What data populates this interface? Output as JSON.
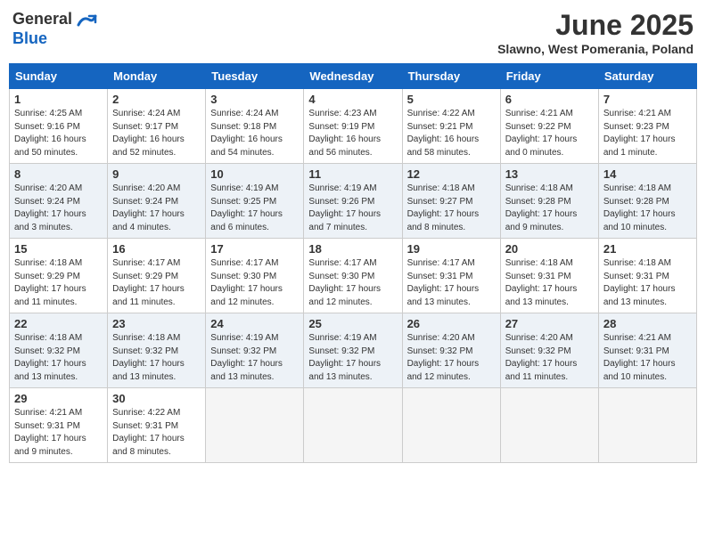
{
  "header": {
    "logo_general": "General",
    "logo_blue": "Blue",
    "month_title": "June 2025",
    "subtitle": "Slawno, West Pomerania, Poland"
  },
  "days_of_week": [
    "Sunday",
    "Monday",
    "Tuesday",
    "Wednesday",
    "Thursday",
    "Friday",
    "Saturday"
  ],
  "weeks": [
    [
      {
        "day": "1",
        "sunrise": "4:25 AM",
        "sunset": "9:16 PM",
        "daylight": "16 hours and 50 minutes."
      },
      {
        "day": "2",
        "sunrise": "4:24 AM",
        "sunset": "9:17 PM",
        "daylight": "16 hours and 52 minutes."
      },
      {
        "day": "3",
        "sunrise": "4:24 AM",
        "sunset": "9:18 PM",
        "daylight": "16 hours and 54 minutes."
      },
      {
        "day": "4",
        "sunrise": "4:23 AM",
        "sunset": "9:19 PM",
        "daylight": "16 hours and 56 minutes."
      },
      {
        "day": "5",
        "sunrise": "4:22 AM",
        "sunset": "9:21 PM",
        "daylight": "16 hours and 58 minutes."
      },
      {
        "day": "6",
        "sunrise": "4:21 AM",
        "sunset": "9:22 PM",
        "daylight": "17 hours and 0 minutes."
      },
      {
        "day": "7",
        "sunrise": "4:21 AM",
        "sunset": "9:23 PM",
        "daylight": "17 hours and 1 minute."
      }
    ],
    [
      {
        "day": "8",
        "sunrise": "4:20 AM",
        "sunset": "9:24 PM",
        "daylight": "17 hours and 3 minutes."
      },
      {
        "day": "9",
        "sunrise": "4:20 AM",
        "sunset": "9:24 PM",
        "daylight": "17 hours and 4 minutes."
      },
      {
        "day": "10",
        "sunrise": "4:19 AM",
        "sunset": "9:25 PM",
        "daylight": "17 hours and 6 minutes."
      },
      {
        "day": "11",
        "sunrise": "4:19 AM",
        "sunset": "9:26 PM",
        "daylight": "17 hours and 7 minutes."
      },
      {
        "day": "12",
        "sunrise": "4:18 AM",
        "sunset": "9:27 PM",
        "daylight": "17 hours and 8 minutes."
      },
      {
        "day": "13",
        "sunrise": "4:18 AM",
        "sunset": "9:28 PM",
        "daylight": "17 hours and 9 minutes."
      },
      {
        "day": "14",
        "sunrise": "4:18 AM",
        "sunset": "9:28 PM",
        "daylight": "17 hours and 10 minutes."
      }
    ],
    [
      {
        "day": "15",
        "sunrise": "4:18 AM",
        "sunset": "9:29 PM",
        "daylight": "17 hours and 11 minutes."
      },
      {
        "day": "16",
        "sunrise": "4:17 AM",
        "sunset": "9:29 PM",
        "daylight": "17 hours and 11 minutes."
      },
      {
        "day": "17",
        "sunrise": "4:17 AM",
        "sunset": "9:30 PM",
        "daylight": "17 hours and 12 minutes."
      },
      {
        "day": "18",
        "sunrise": "4:17 AM",
        "sunset": "9:30 PM",
        "daylight": "17 hours and 12 minutes."
      },
      {
        "day": "19",
        "sunrise": "4:17 AM",
        "sunset": "9:31 PM",
        "daylight": "17 hours and 13 minutes."
      },
      {
        "day": "20",
        "sunrise": "4:18 AM",
        "sunset": "9:31 PM",
        "daylight": "17 hours and 13 minutes."
      },
      {
        "day": "21",
        "sunrise": "4:18 AM",
        "sunset": "9:31 PM",
        "daylight": "17 hours and 13 minutes."
      }
    ],
    [
      {
        "day": "22",
        "sunrise": "4:18 AM",
        "sunset": "9:32 PM",
        "daylight": "17 hours and 13 minutes."
      },
      {
        "day": "23",
        "sunrise": "4:18 AM",
        "sunset": "9:32 PM",
        "daylight": "17 hours and 13 minutes."
      },
      {
        "day": "24",
        "sunrise": "4:19 AM",
        "sunset": "9:32 PM",
        "daylight": "17 hours and 13 minutes."
      },
      {
        "day": "25",
        "sunrise": "4:19 AM",
        "sunset": "9:32 PM",
        "daylight": "17 hours and 13 minutes."
      },
      {
        "day": "26",
        "sunrise": "4:20 AM",
        "sunset": "9:32 PM",
        "daylight": "17 hours and 12 minutes."
      },
      {
        "day": "27",
        "sunrise": "4:20 AM",
        "sunset": "9:32 PM",
        "daylight": "17 hours and 11 minutes."
      },
      {
        "day": "28",
        "sunrise": "4:21 AM",
        "sunset": "9:31 PM",
        "daylight": "17 hours and 10 minutes."
      }
    ],
    [
      {
        "day": "29",
        "sunrise": "4:21 AM",
        "sunset": "9:31 PM",
        "daylight": "17 hours and 9 minutes."
      },
      {
        "day": "30",
        "sunrise": "4:22 AM",
        "sunset": "9:31 PM",
        "daylight": "17 hours and 8 minutes."
      },
      null,
      null,
      null,
      null,
      null
    ]
  ]
}
